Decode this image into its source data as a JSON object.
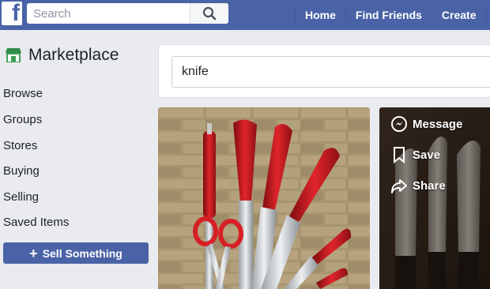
{
  "topbar": {
    "logo_letter": "f",
    "search_placeholder": "Search",
    "nav": [
      "Home",
      "Find Friends",
      "Create"
    ]
  },
  "sidebar": {
    "title": "Marketplace",
    "items": [
      "Browse",
      "Groups",
      "Stores",
      "Buying",
      "Selling",
      "Saved Items"
    ],
    "sell_button": "Sell Something"
  },
  "main": {
    "search_value": "knife"
  },
  "listing_actions": [
    "Message",
    "Save",
    "Share"
  ],
  "colors": {
    "brand": "#4a63a6",
    "background": "#e9ebee"
  }
}
